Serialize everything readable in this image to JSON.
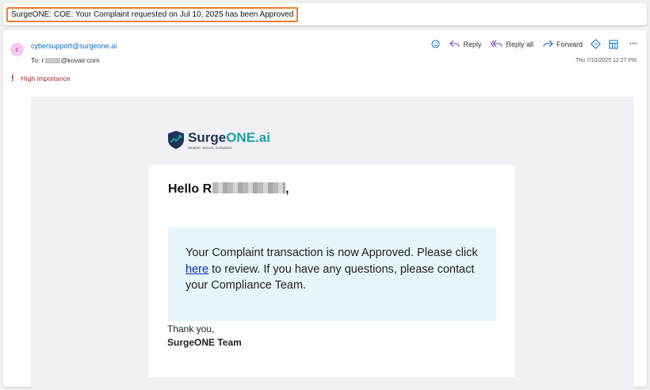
{
  "subject": "SurgeONE: COE: Your Complaint requested on Jul 10, 2025 has been Approved",
  "sender": {
    "avatar_initial": "c",
    "email": "cybersupport@surgeone.ai",
    "to_label": "To:",
    "to_prefix": "r",
    "to_domain": "@kovair.com",
    "date": "Thu 7/10/2025 12:27 PM"
  },
  "actions": {
    "emoji_icon": "smiley-icon",
    "reply_label": "Reply",
    "reply_all_label": "Reply all",
    "forward_label": "Forward",
    "more_label": "···"
  },
  "importance": {
    "mark": "!",
    "label": "High importance"
  },
  "body": {
    "logo": {
      "name_part1": "Surge",
      "name_part2": "ONE.ai",
      "tagline": "Smarter. Secure. Compliant"
    },
    "greeting_prefix": "Hello R",
    "greeting_suffix": ",",
    "message_before": "Your Complaint transaction is now Approved. Please click",
    "link_text": "here",
    "message_after": "to review. If you have any questions, please contact your Compliance Team.",
    "thanks": "Thank you,",
    "team": "SurgeONE Team"
  },
  "colors": {
    "subject_highlight": "#f07f2a",
    "link": "#0f6cbd",
    "importance": "#a4262c",
    "notice_bg": "#e6f5fc",
    "brand_navy": "#1d3557",
    "brand_teal": "#1aa3a3"
  }
}
